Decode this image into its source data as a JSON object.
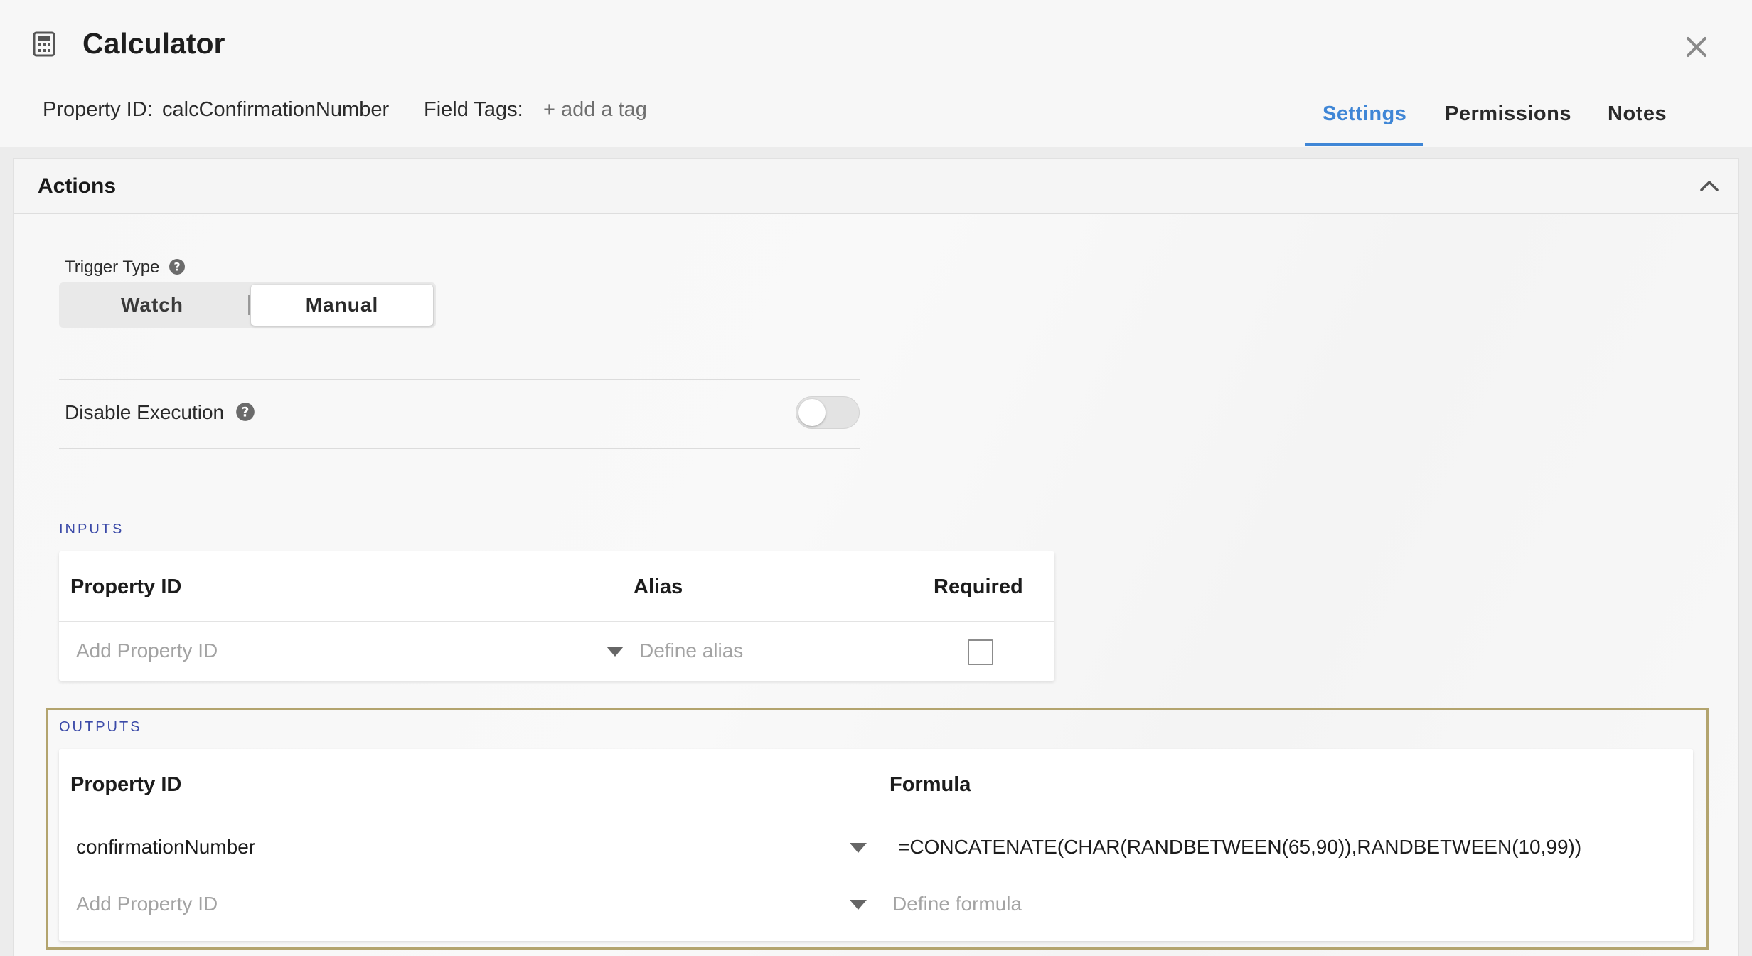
{
  "header": {
    "title": "Calculator",
    "icon": "calculator-icon",
    "property_id_label": "Property ID:",
    "property_id_value": "calcConfirmationNumber",
    "field_tags_label": "Field Tags:",
    "add_tag": "+ add a tag",
    "tabs": [
      {
        "label": "Settings",
        "active": true
      },
      {
        "label": "Permissions",
        "active": false
      },
      {
        "label": "Notes",
        "active": false
      }
    ]
  },
  "actions": {
    "title": "Actions",
    "trigger_type_label": "Trigger Type",
    "trigger_options": [
      "Watch",
      "Manual"
    ],
    "trigger_selected": "Manual",
    "disable_execution_label": "Disable Execution",
    "disable_execution_on": false
  },
  "inputs": {
    "label": "INPUTS",
    "headers": [
      "Property ID",
      "Alias",
      "Required"
    ],
    "row": {
      "property_placeholder": "Add Property ID",
      "alias_placeholder": "Define alias",
      "required": false
    }
  },
  "outputs": {
    "label": "OUTPUTS",
    "headers": [
      "Property ID",
      "Formula"
    ],
    "rows": [
      {
        "property_id": "confirmationNumber",
        "formula": "=CONCATENATE(CHAR(RANDBETWEEN(65,90)),RANDBETWEEN(10,99))"
      }
    ],
    "new_row": {
      "property_placeholder": "Add Property ID",
      "formula_placeholder": "Define formula"
    }
  },
  "colors": {
    "accent": "#3f86d6",
    "section_caps": "#3b4aa8",
    "highlight_border": "#b3a46e"
  }
}
